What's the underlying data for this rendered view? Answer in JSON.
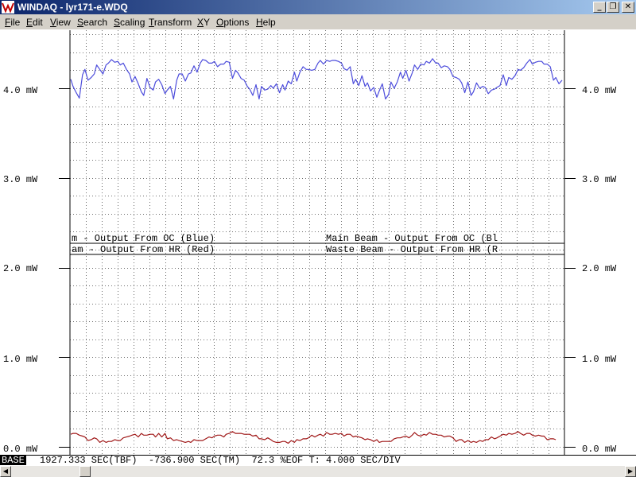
{
  "window": {
    "title": "WINDAQ - lyr171-e.WDQ",
    "buttons": {
      "minimize": "_",
      "restore": "❐",
      "close": "✕"
    }
  },
  "menu": [
    "File",
    "Edit",
    "View",
    "Search",
    "Scaling",
    "Transform",
    "XY",
    "Options",
    "Help"
  ],
  "plot": {
    "y_ticks": [
      "4.0 mW",
      "3.0 mW",
      "2.0 mW",
      "1.0 mW",
      "0.0 mW"
    ],
    "channel_labels": {
      "left_row1": "m - Output From OC (Blue)",
      "left_row2": "am - Output From HR (Red)",
      "right_row1": "Main Beam - Output From OC (Bl",
      "right_row2": "Waste Beam - Output From HR (R"
    }
  },
  "chart_data": {
    "type": "line",
    "ylim": [
      0.0,
      4.0
    ],
    "grid": true,
    "x": [
      1,
      4,
      8,
      12,
      16,
      19,
      23,
      27,
      31,
      34,
      38,
      42,
      46,
      49,
      53,
      57,
      61,
      64,
      68,
      72,
      76,
      79,
      83,
      87,
      91,
      94,
      98,
      102,
      106,
      109,
      113,
      117,
      121,
      124,
      128,
      132,
      136,
      139,
      143,
      147,
      151,
      154,
      158,
      162,
      166,
      169,
      173,
      177,
      181,
      184,
      188,
      192,
      196,
      199,
      203,
      207,
      211,
      214,
      218,
      222,
      226,
      229,
      233,
      237,
      241,
      244,
      248,
      252,
      256,
      259,
      263,
      267,
      271,
      274,
      278,
      282,
      286,
      289,
      293,
      297,
      301,
      304,
      308,
      312,
      316,
      319,
      323,
      327,
      331,
      334,
      338,
      342,
      346,
      349,
      353,
      357,
      361,
      364,
      368,
      372,
      376,
      379,
      383,
      387,
      391,
      394,
      398,
      402,
      406,
      409,
      413,
      417,
      421,
      424,
      428,
      432,
      436,
      439,
      443,
      447,
      451,
      454,
      458,
      462,
      466,
      469,
      473,
      477,
      481,
      484,
      488,
      492,
      496,
      499,
      503,
      507,
      511,
      514,
      518,
      522,
      526,
      529,
      533,
      537,
      541,
      544,
      548,
      552,
      556,
      559,
      563,
      567,
      571,
      574,
      578,
      582,
      586,
      589,
      593,
      597,
      601,
      604,
      608,
      612,
      616,
      619,
      623,
      627
    ],
    "series": [
      {
        "color": "#4d4ddc",
        "values": [
          4.1,
          4.02,
          3.95,
          3.89,
          4.15,
          4.21,
          4.09,
          4.12,
          4.16,
          4.26,
          4.21,
          4.16,
          4.26,
          4.28,
          4.32,
          4.29,
          4.3,
          4.26,
          4.28,
          4.21,
          4.16,
          4.07,
          4.13,
          4.05,
          3.96,
          3.92,
          4.11,
          4.01,
          3.98,
          4.07,
          4.1,
          4.04,
          3.94,
          3.98,
          4.02,
          3.88,
          4.09,
          4.16,
          4.16,
          4.08,
          4.16,
          4.17,
          4.25,
          4.18,
          4.28,
          4.32,
          4.31,
          4.28,
          4.28,
          4.3,
          4.24,
          4.27,
          4.27,
          4.3,
          4.29,
          4.11,
          4.2,
          4.17,
          4.11,
          4.09,
          4.02,
          3.99,
          3.92,
          4.04,
          3.88,
          4.02,
          3.98,
          3.99,
          4.03,
          4.0,
          4.05,
          3.95,
          4.04,
          3.98,
          4.08,
          4.05,
          4.18,
          4.08,
          4.18,
          4.24,
          4.21,
          4.21,
          4.2,
          4.21,
          4.28,
          4.31,
          4.27,
          4.31,
          4.3,
          4.31,
          4.31,
          4.3,
          4.28,
          4.22,
          4.2,
          4.24,
          4.05,
          4.1,
          4.03,
          4.14,
          4.02,
          4.06,
          3.97,
          4.01,
          3.9,
          3.97,
          4.05,
          3.88,
          3.93,
          4.07,
          4.0,
          4.07,
          4.18,
          4.11,
          4.2,
          4.08,
          4.17,
          4.26,
          4.21,
          4.27,
          4.26,
          4.3,
          4.28,
          4.33,
          4.28,
          4.28,
          4.23,
          4.25,
          4.24,
          4.21,
          4.13,
          4.12,
          4.1,
          4.06,
          3.95,
          4.07,
          3.92,
          3.96,
          4.06,
          4.0,
          4.02,
          4.01,
          3.94,
          3.98,
          3.99,
          4.01,
          4.03,
          4.15,
          4.03,
          4.12,
          4.1,
          4.14,
          4.21,
          4.2,
          4.23,
          4.28,
          4.32,
          4.27,
          4.29,
          4.3,
          4.3,
          4.27,
          4.27,
          4.24,
          4.09,
          4.12,
          4.05,
          4.09,
          3.91,
          4.02
        ]
      },
      {
        "color": "#a01818",
        "values": [
          0.14,
          0.15,
          0.15,
          0.13,
          0.12,
          0.11,
          0.07,
          0.08,
          0.1,
          0.09,
          0.05,
          0.07,
          0.05,
          0.06,
          0.06,
          0.08,
          0.07,
          0.07,
          0.1,
          0.11,
          0.12,
          0.13,
          0.14,
          0.11,
          0.15,
          0.13,
          0.13,
          0.14,
          0.14,
          0.11,
          0.15,
          0.11,
          0.15,
          0.09,
          0.1,
          0.07,
          0.08,
          0.07,
          0.06,
          0.05,
          0.06,
          0.05,
          0.08,
          0.07,
          0.07,
          0.07,
          0.09,
          0.11,
          0.1,
          0.12,
          0.13,
          0.13,
          0.11,
          0.14,
          0.15,
          0.17,
          0.15,
          0.15,
          0.15,
          0.14,
          0.14,
          0.14,
          0.12,
          0.13,
          0.09,
          0.09,
          0.08,
          0.1,
          0.08,
          0.06,
          0.05,
          0.05,
          0.06,
          0.06,
          0.04,
          0.07,
          0.05,
          0.08,
          0.07,
          0.09,
          0.09,
          0.1,
          0.13,
          0.11,
          0.13,
          0.14,
          0.12,
          0.16,
          0.14,
          0.14,
          0.15,
          0.14,
          0.15,
          0.12,
          0.14,
          0.14,
          0.11,
          0.12,
          0.11,
          0.1,
          0.08,
          0.09,
          0.08,
          0.06,
          0.08,
          0.05,
          0.06,
          0.06,
          0.06,
          0.06,
          0.09,
          0.1,
          0.1,
          0.11,
          0.12,
          0.1,
          0.13,
          0.16,
          0.13,
          0.12,
          0.14,
          0.13,
          0.16,
          0.14,
          0.14,
          0.13,
          0.13,
          0.11,
          0.12,
          0.12,
          0.1,
          0.06,
          0.08,
          0.08,
          0.05,
          0.07,
          0.05,
          0.06,
          0.05,
          0.07,
          0.06,
          0.08,
          0.08,
          0.11,
          0.09,
          0.1,
          0.12,
          0.14,
          0.13,
          0.15,
          0.14,
          0.15,
          0.17,
          0.15,
          0.13,
          0.15,
          0.15,
          0.13,
          0.12,
          0.13,
          0.12,
          0.12,
          0.08,
          0.09,
          0.09,
          0.08
        ]
      }
    ]
  },
  "status": {
    "base": "BASE",
    "text": "1927.333 SEC(TBF)  -736.900 SEC(TM)  72.3 %EOF T: 4.000 SEC/DIV"
  },
  "scrollbar": {
    "left_arrow": "◀",
    "right_arrow": "▶"
  }
}
